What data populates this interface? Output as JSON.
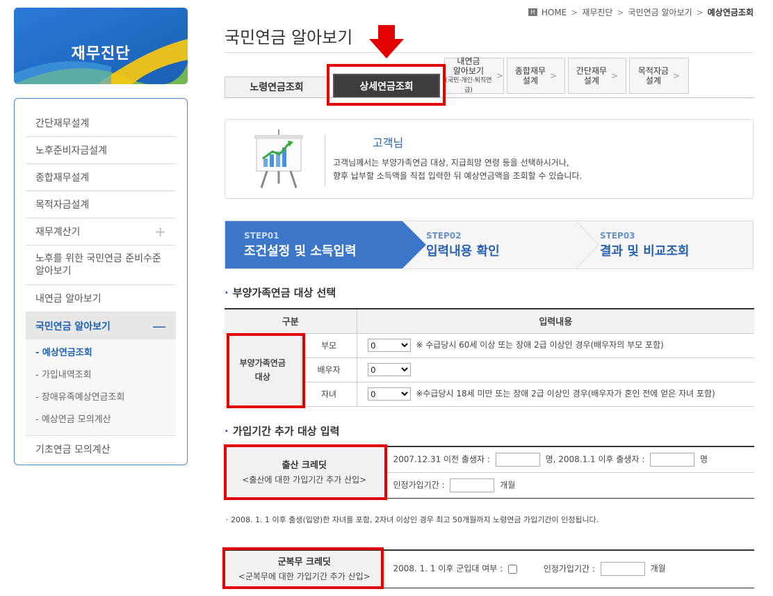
{
  "sidebar": {
    "banner_title": "재무진단",
    "items": [
      {
        "label": "간단재무설계"
      },
      {
        "label": "노후준비자금설계"
      },
      {
        "label": "종합재무설계"
      },
      {
        "label": "목적자금설계"
      },
      {
        "label": "재무계산기",
        "toggle": "+"
      },
      {
        "label": "노후를 위한 국민연금 준비수준 알아보기"
      },
      {
        "label": "내연금 알아보기"
      },
      {
        "label": "국민연금 알아보기",
        "toggle": "—"
      },
      {
        "label": "기초연금 모의계산"
      }
    ],
    "sub_items": [
      {
        "label": "- 예상연금조회"
      },
      {
        "label": "- 가입내역조회"
      },
      {
        "label": "- 장애유족예상연금조회"
      },
      {
        "label": "- 예상연금 모의계산"
      }
    ]
  },
  "breadcrumb": {
    "home_icon": "H",
    "home": "HOME",
    "items": [
      "재무진단",
      "국민연금 알아보기"
    ],
    "current": "예상연금조회",
    "sep": ">"
  },
  "page_title": "국민연금 알아보기",
  "tabs": {
    "old_age": "노령연금조회",
    "detail": "상세연금조회",
    "my_pension_line1": "내연금",
    "my_pension_line2": "알아보기",
    "my_pension_sub": "(국민·개인·퇴직연금)",
    "comprehensive_line1": "종합재무",
    "comprehensive_line2": "설계",
    "simple_line1": "간단재무",
    "simple_line2": "설계",
    "purpose_line1": "목적자금",
    "purpose_line2": "설계",
    "arrow": ">"
  },
  "info": {
    "name": "고객님",
    "line1": "고객님께서는 부양가족연금 대상, 지급희망 연령 등을 선택하시거나,",
    "line2": "향후 납부할 소득액을 직접 입력한 뒤 예상연금액을 조회할 수 있습니다."
  },
  "steps": [
    {
      "num": "STEP01",
      "label": "조건설정 및 소득입력"
    },
    {
      "num": "STEP02",
      "label": "입력내용 확인"
    },
    {
      "num": "STEP03",
      "label": "결과 및 비교조회"
    }
  ],
  "dependent": {
    "title": "부양가족연금 대상 선택",
    "header_category": "구분",
    "header_input": "입력내용",
    "row_head_line1": "부양가족연금",
    "row_head_line2": "대상",
    "rows": [
      {
        "label": "부모",
        "value": "0",
        "note": "※ 수급당시 60세 이상 또는 장애 2급 이상인 경우(배우자의 부모 포함)"
      },
      {
        "label": "배우자",
        "value": "0",
        "note": ""
      },
      {
        "label": "자녀",
        "value": "0",
        "note": "※수급당시 18세 미만 또는 장애 2급 이상인 경우(배우자가 혼인 전에 얻은 자녀 포함)"
      }
    ]
  },
  "period": {
    "title": "가입기간 추가 대상 입력",
    "birth_credit": {
      "title": "출산 크레딧",
      "subtitle": "<출산에 대한 가입기간 추가 산입>",
      "before_label": "2007.12.31 이전 출생자 :",
      "mid_label": "명, 2008.1.1 이후 출생자 :",
      "unit_people": "명",
      "recognized_label": "인정가입기간 :",
      "unit_month": "개월"
    },
    "note": "· 2008. 1. 1 이후 출생(입양)한 자녀를 포함, 2자녀 이상인 경우 최고 50개월까지 노령연금 가입기간이 인정됩니다.",
    "military_credit": {
      "title": "군복무 크레딧",
      "subtitle": "<군복무에 대한 가입기간 추가 산입>",
      "enlist_label": "2008. 1. 1 이후 군입대 여부 :",
      "recognized_label": "인정가입기간 :",
      "unit_month": "개월"
    }
  },
  "colors": {
    "brand_blue": "#1e6ec8",
    "highlight_red": "#e30000",
    "step_active": "#3c76c8"
  }
}
